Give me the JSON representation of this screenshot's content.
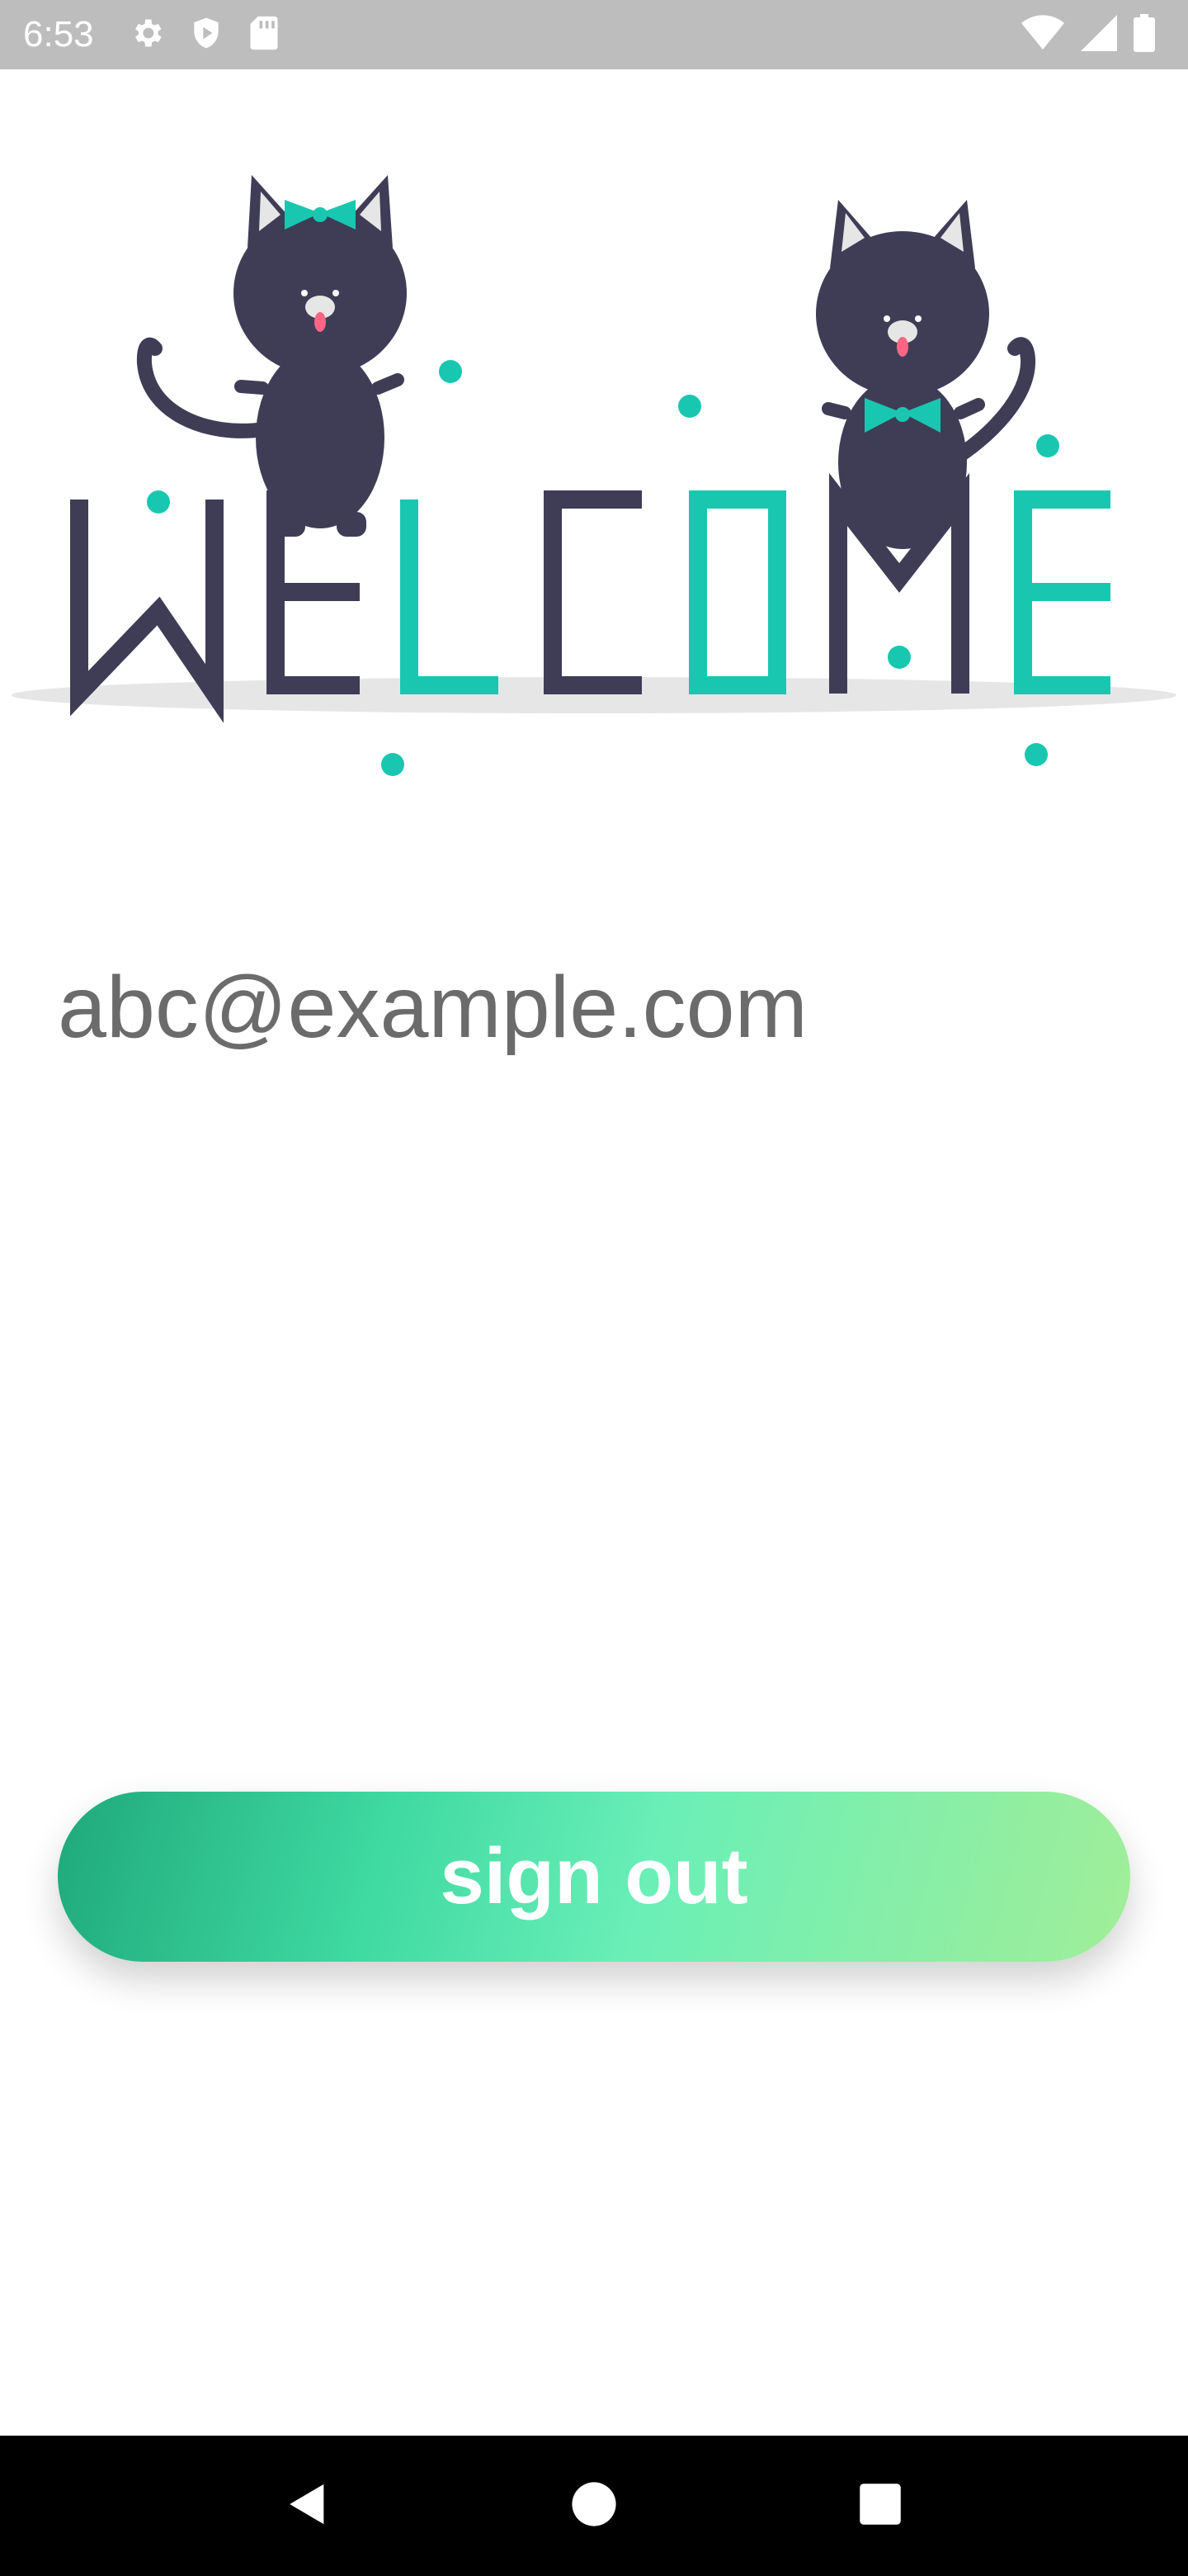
{
  "status_bar": {
    "time": "6:53",
    "left_icons": [
      "gear-icon",
      "shield-icon",
      "sd-card-icon"
    ],
    "right_icons": [
      "wifi-icon",
      "cellular-signal-icon",
      "battery-icon"
    ]
  },
  "hero": {
    "illustration": "welcome-cats-illustration",
    "banner_text": "WELCOME",
    "colors": {
      "dark": "#3f3d56",
      "accent": "#19c7b0",
      "shadow": "#e6e6e6"
    }
  },
  "account": {
    "email": "abc@example.com"
  },
  "actions": {
    "sign_out_label": "sign out"
  },
  "nav_bar": {
    "buttons": [
      "back-icon",
      "home-icon",
      "recents-icon"
    ]
  }
}
